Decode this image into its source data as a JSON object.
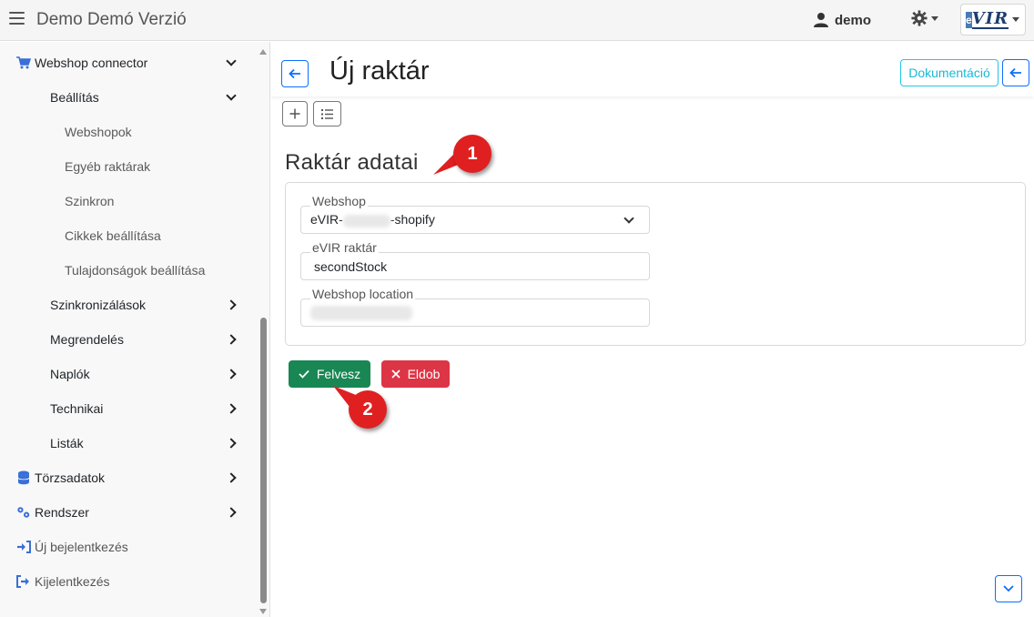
{
  "header": {
    "app_title": "Demo Demó Verzió",
    "user_name": "demo",
    "logo_text": "VIR",
    "logo_letter": "e"
  },
  "sidebar": {
    "items": [
      {
        "label": "Webshop connector",
        "icon": "cart-icon",
        "state": "expanded"
      },
      {
        "label": "Beállítás",
        "state": "expanded"
      },
      {
        "label": "Webshopok"
      },
      {
        "label": "Egyéb raktárak"
      },
      {
        "label": "Szinkron"
      },
      {
        "label": "Cikkek beállítása"
      },
      {
        "label": "Tulajdonságok beállítása"
      },
      {
        "label": "Szinkronizálások",
        "state": "collapsed"
      },
      {
        "label": "Megrendelés",
        "state": "collapsed"
      },
      {
        "label": "Naplók",
        "state": "collapsed"
      },
      {
        "label": "Technikai",
        "state": "collapsed"
      },
      {
        "label": "Listák",
        "state": "collapsed"
      },
      {
        "label": "Törzsadatok",
        "icon": "database-icon",
        "state": "collapsed"
      },
      {
        "label": "Rendszer",
        "icon": "gears-icon",
        "state": "collapsed"
      },
      {
        "label": "Új bejelentkezés",
        "icon": "sign-in-icon"
      },
      {
        "label": "Kijelentkezés",
        "icon": "sign-out-icon"
      }
    ]
  },
  "main": {
    "page_title": "Új raktár",
    "doc_button": "Dokumentáció",
    "section_title": "Raktár adatai",
    "form": {
      "webshop_label": "Webshop",
      "webshop_value_prefix": "eVIR-",
      "webshop_value_suffix": "-shopify",
      "evir_stock_label": "eVIR raktár",
      "evir_stock_value": "secondStock",
      "location_label": "Webshop location"
    },
    "buttons": {
      "add": "Felvesz",
      "discard": "Eldob"
    }
  },
  "annotations": {
    "badge_1": "1",
    "badge_2": "2"
  },
  "colors": {
    "primary": "#0d6efd",
    "success": "#198754",
    "danger": "#dc3545",
    "info": "#1ab8d4",
    "annotation": "#e02020"
  }
}
